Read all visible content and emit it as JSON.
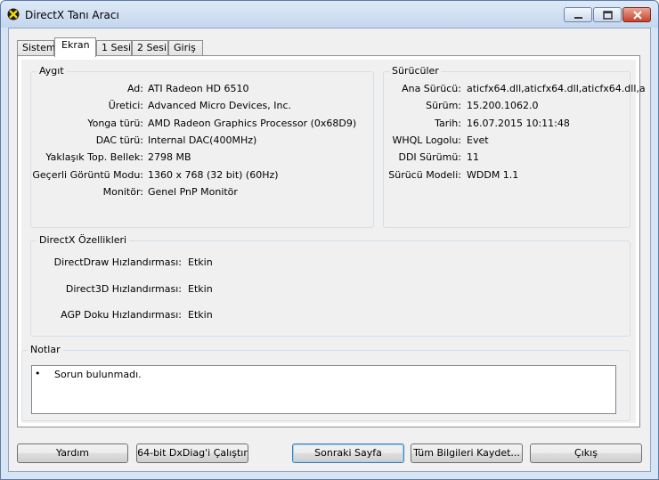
{
  "window": {
    "title": "DirectX Tanı Aracı"
  },
  "tabs": [
    {
      "label": "Sistem"
    },
    {
      "label": "Ekran"
    },
    {
      "label": "1 Sesi"
    },
    {
      "label": "2 Sesi"
    },
    {
      "label": "Giriş"
    }
  ],
  "device": {
    "title": "Aygıt",
    "rows": [
      {
        "label": "Ad:",
        "value": "ATI Radeon HD 6510"
      },
      {
        "label": "Üretici:",
        "value": "Advanced Micro Devices, Inc."
      },
      {
        "label": "Yonga türü:",
        "value": "AMD Radeon Graphics Processor (0x68D9)"
      },
      {
        "label": "DAC türü:",
        "value": "Internal DAC(400MHz)"
      },
      {
        "label": "Yaklaşık Top. Bellek:",
        "value": "2798 MB"
      },
      {
        "label": "Geçerli Görüntü Modu:",
        "value": "1360 x 768 (32 bit) (60Hz)"
      },
      {
        "label": "Monitör:",
        "value": "Genel PnP Monitör"
      }
    ]
  },
  "drivers": {
    "title": "Sürücüler",
    "rows": [
      {
        "label": "Ana Sürücü:",
        "value": "aticfx64.dll,aticfx64.dll,aticfx64.dll,a"
      },
      {
        "label": "Sürüm:",
        "value": "15.200.1062.0"
      },
      {
        "label": "Tarih:",
        "value": "16.07.2015 10:11:48"
      },
      {
        "label": "WHQL Logolu:",
        "value": "Evet"
      },
      {
        "label": "DDI Sürümü:",
        "value": "11"
      },
      {
        "label": "Sürücü Modeli:",
        "value": "WDDM 1.1"
      }
    ]
  },
  "features": {
    "title": "DirectX Özellikleri",
    "rows": [
      {
        "label": "DirectDraw Hızlandırması:",
        "value": "Etkin"
      },
      {
        "label": "Direct3D Hızlandırması:",
        "value": "Etkin"
      },
      {
        "label": "AGP Doku Hızlandırması:",
        "value": "Etkin"
      }
    ]
  },
  "notes": {
    "title": "Notlar",
    "bullet": "•",
    "text": "Sorun bulunmadı."
  },
  "buttons": {
    "help": "Yardım",
    "run64": "64-bit DxDiag'i Çalıştır",
    "next": "Sonraki Sayfa",
    "save": "Tüm Bilgileri Kaydet...",
    "exit": "Çıkış"
  }
}
